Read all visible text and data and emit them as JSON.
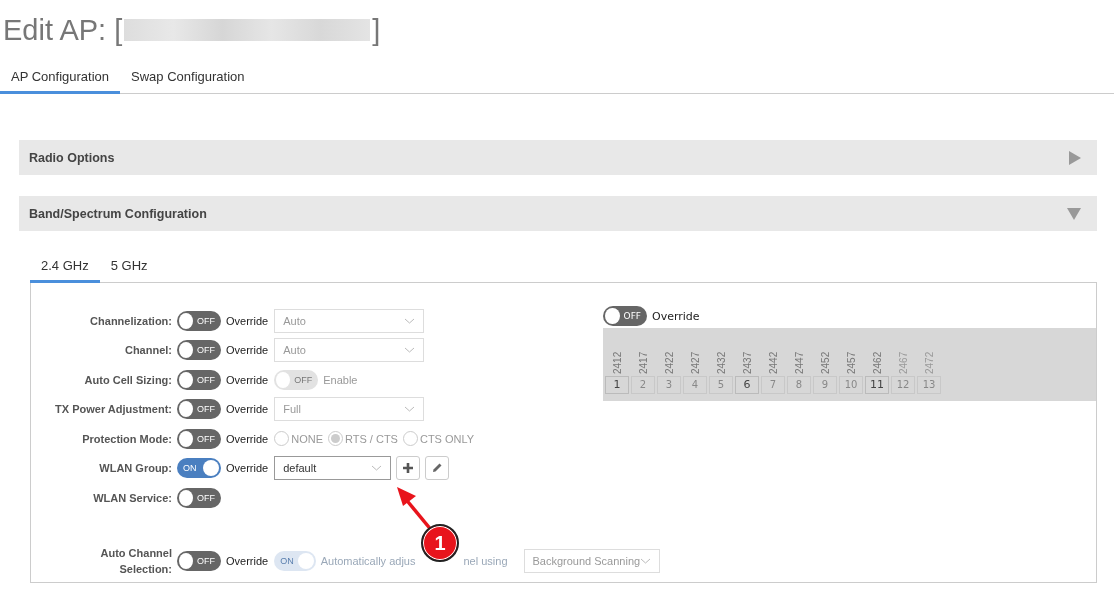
{
  "page_title": {
    "prefix": "Edit AP: [",
    "suffix": "]",
    "redacted": true
  },
  "tabs": [
    {
      "label": "AP Configuration",
      "selected": true
    },
    {
      "label": "Swap Configuration",
      "selected": false
    }
  ],
  "sections": [
    {
      "title": "Radio Options",
      "expanded": false
    },
    {
      "title": "Band/Spectrum Configuration",
      "expanded": true
    }
  ],
  "band_tabs": [
    {
      "label": "2.4 GHz",
      "selected": true
    },
    {
      "label": "5 GHz",
      "selected": false
    }
  ],
  "settings": [
    {
      "kind": "select",
      "label": "Channelization:",
      "override": {
        "on": false,
        "text": "OFF"
      },
      "override_label": "Override",
      "value": "Auto",
      "disabled": true
    },
    {
      "kind": "select",
      "label": "Channel:",
      "override": {
        "on": false,
        "text": "OFF"
      },
      "override_label": "Override",
      "value": "Auto",
      "disabled": true
    },
    {
      "kind": "toggle",
      "label": "Auto Cell Sizing:",
      "override": {
        "on": false,
        "text": "OFF"
      },
      "override_label": "Override",
      "toggle": {
        "on": false,
        "text": "OFF"
      },
      "toggle_label": "Enable",
      "disabled": true
    },
    {
      "kind": "select",
      "label": "TX Power Adjustment:",
      "override": {
        "on": false,
        "text": "OFF"
      },
      "override_label": "Override",
      "value": "Full",
      "disabled": true
    },
    {
      "kind": "radios",
      "label": "Protection Mode:",
      "override": {
        "on": false,
        "text": "OFF"
      },
      "override_label": "Override",
      "disabled": true,
      "options": [
        {
          "label": "NONE",
          "selected": false
        },
        {
          "label": "RTS / CTS",
          "selected": true
        },
        {
          "label": "CTS ONLY",
          "selected": false
        }
      ]
    },
    {
      "kind": "select_buttons",
      "label": "WLAN Group:",
      "override": {
        "on": true,
        "text": "ON"
      },
      "override_label": "Override",
      "value": "default",
      "disabled": false
    },
    {
      "kind": "none",
      "label": "WLAN Service:",
      "override": {
        "on": false,
        "text": "OFF"
      }
    },
    {
      "kind": "auto_channel",
      "label": "Auto Channel Selection:",
      "override": {
        "on": false,
        "text": "OFF"
      },
      "override_label": "Override",
      "toggle": {
        "on": true,
        "text": "ON"
      },
      "toggle_label_parts": [
        "Automatically adjus",
        "nel using"
      ],
      "value": "Background Scanning",
      "disabled": true
    }
  ],
  "channel_override": {
    "toggle": {
      "on": false,
      "text": "OFF"
    },
    "label": "Override"
  },
  "channels": [
    {
      "number": "1",
      "frequency": "2412",
      "highlighted": true,
      "available": true
    },
    {
      "number": "2",
      "frequency": "2417",
      "highlighted": false,
      "available": true
    },
    {
      "number": "3",
      "frequency": "2422",
      "highlighted": false,
      "available": true
    },
    {
      "number": "4",
      "frequency": "2427",
      "highlighted": false,
      "available": true
    },
    {
      "number": "5",
      "frequency": "2432",
      "highlighted": false,
      "available": true
    },
    {
      "number": "6",
      "frequency": "2437",
      "highlighted": true,
      "available": true
    },
    {
      "number": "7",
      "frequency": "2442",
      "highlighted": false,
      "available": true
    },
    {
      "number": "8",
      "frequency": "2447",
      "highlighted": false,
      "available": true
    },
    {
      "number": "9",
      "frequency": "2452",
      "highlighted": false,
      "available": true
    },
    {
      "number": "10",
      "frequency": "2457",
      "highlighted": false,
      "available": true
    },
    {
      "number": "11",
      "frequency": "2462",
      "highlighted": true,
      "available": true
    },
    {
      "number": "12",
      "frequency": "2467",
      "highlighted": false,
      "available": false
    },
    {
      "number": "13",
      "frequency": "2472",
      "highlighted": false,
      "available": false
    }
  ],
  "annotation": {
    "label": "1"
  }
}
